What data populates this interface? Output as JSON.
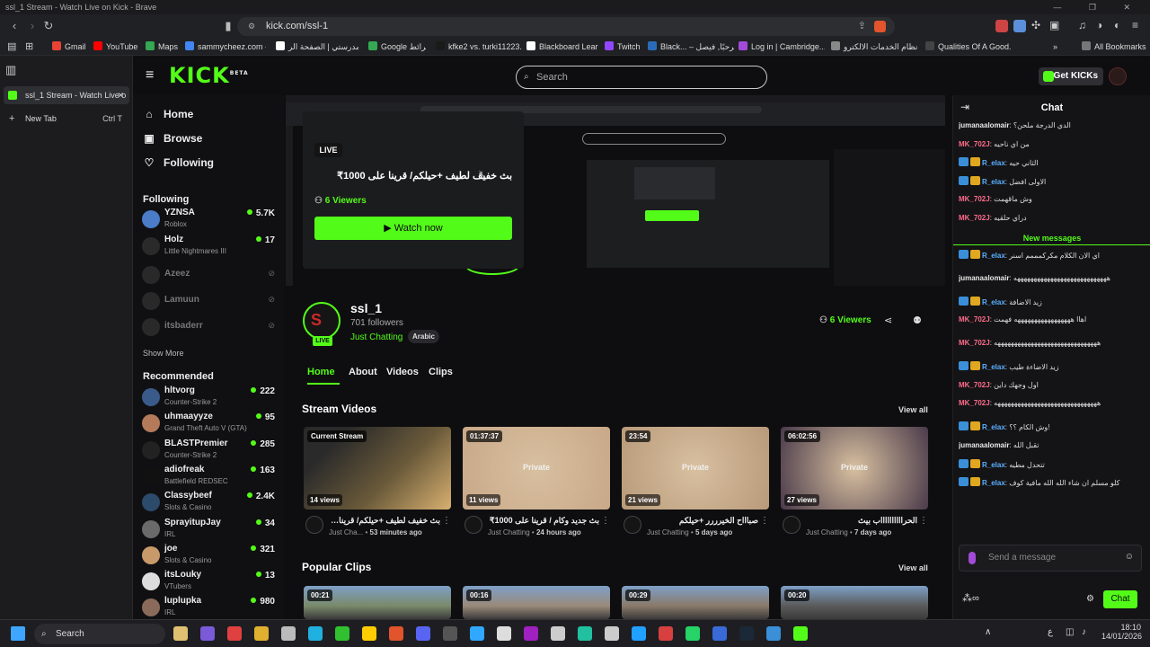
{
  "window": {
    "title": "ssl_1 Stream - Watch Live on Kick - Brave"
  },
  "browser": {
    "url": "kick.com/ssl-1",
    "bookmarks": [
      "Gmail",
      "YouTube",
      "Maps",
      "sammycheez.com -...",
      "مدرستي | الصفحة الر...",
      "Google خرائط",
      "kfke2 vs. turki11223...",
      "Blackboard Learn",
      "Twitch",
      "Black... – مرحبًا, فيصل",
      "Log in | Cambridge...",
      "نظام الخدمات الالكترو...",
      "Qualities Of A Good..."
    ],
    "all_bookmarks": "All Bookmarks",
    "tabs": [
      {
        "label": "ssl_1 Stream - Watch Live o"
      },
      {
        "label": "New Tab",
        "shortcut": "Ctrl T"
      }
    ]
  },
  "kick": {
    "logo": "KICK",
    "logo_beta": "BETA",
    "search_placeholder": "Search",
    "get_kicks": "Get KICKs",
    "nav": {
      "home": "Home",
      "browse": "Browse",
      "following": "Following"
    },
    "following_heading": "Following",
    "following": [
      {
        "name": "YZNSA",
        "game": "Roblox",
        "viewers": "5.7K",
        "color": "#4a7cc7"
      },
      {
        "name": "Holz",
        "game": "Little Nightmares III",
        "viewers": "17",
        "color": "#2a2a2a"
      }
    ],
    "following_offline": [
      {
        "name": "Azeez"
      },
      {
        "name": "Lamuun"
      },
      {
        "name": "itsbaderr"
      }
    ],
    "show_more": "Show More",
    "recommended_heading": "Recommended",
    "recommended": [
      {
        "name": "hltvorg",
        "game": "Counter-Strike 2",
        "viewers": "222",
        "color": "#3a5a8a"
      },
      {
        "name": "uhmaayyze",
        "game": "Grand Theft Auto V (GTA)",
        "viewers": "95",
        "color": "#b47a5a"
      },
      {
        "name": "BLASTPremier",
        "game": "Counter-Strike 2",
        "viewers": "285",
        "color": "#222222"
      },
      {
        "name": "adiofreak",
        "game": "Battlefield REDSEC",
        "viewers": "163",
        "color": "#111111"
      },
      {
        "name": "Classybeef",
        "game": "Slots & Casino",
        "viewers": "2.4K",
        "color": "#2c4a6a"
      },
      {
        "name": "SprayitupJay",
        "game": "IRL",
        "viewers": "34",
        "color": "#6a6a6a"
      },
      {
        "name": "joe",
        "game": "Slots & Casino",
        "viewers": "321",
        "color": "#c89a6a"
      },
      {
        "name": "itsLouky",
        "game": "VTubers",
        "viewers": "13",
        "color": "#dddddd"
      },
      {
        "name": "luplupka",
        "game": "IRL",
        "viewers": "980",
        "color": "#8a6a5a"
      }
    ],
    "offline_card": {
      "live_label": "LIVE",
      "title": "بث خفيف لطيف +حيلكم/ قرينا على 1000₹",
      "viewers": "6 Viewers",
      "watch_now": "Watch now"
    },
    "channel": {
      "name": "ssl_1",
      "followers": "701 followers",
      "category": "Just Chatting",
      "tag": "Arabic",
      "live_badge": "LIVE",
      "viewers": "6 Viewers"
    },
    "tabs": [
      "Home",
      "About",
      "Videos",
      "Clips"
    ],
    "stream_videos": {
      "heading": "Stream Videos",
      "view_all": "View all",
      "items": [
        {
          "label": "Current Stream",
          "views": "14 views",
          "private": "",
          "title": "بث خفيف لطيف +حيلكم/ قرينا على 1000₹",
          "channel": "Just Cha...",
          "when": "53 minutes ago",
          "thumb": "#6a5a3a"
        },
        {
          "label": "01:37:37",
          "views": "11 views",
          "private": "Private",
          "title": "بث جديد وكام / قرينا على 1000₹",
          "channel": "Just Chatting",
          "when": "24 hours ago",
          "thumb": "#c8a888"
        },
        {
          "label": "23:54",
          "views": "21 views",
          "private": "Private",
          "title": "صباااح الخيرررر +حيلكم",
          "channel": "Just Chatting",
          "when": "5 days ago",
          "thumb": "#b89a7a"
        },
        {
          "label": "06:02:56",
          "views": "27 views",
          "private": "Private",
          "title": "الحرااااااااااب بيث",
          "channel": "Just Chatting",
          "when": "7 days ago",
          "thumb": "#4a3a4a"
        }
      ]
    },
    "popular_clips": {
      "heading": "Popular Clips",
      "view_all": "View all",
      "items": [
        {
          "label": "00:21",
          "thumb": "#7a8a6a"
        },
        {
          "label": "00:16",
          "thumb": "#9a8a7a"
        },
        {
          "label": "00:29",
          "thumb": "#8a7a6a"
        },
        {
          "label": "00:20",
          "thumb": "#5a5a5a"
        }
      ]
    },
    "chat": {
      "title": "Chat",
      "new_messages": "New messages",
      "input_placeholder": "Send a message",
      "send_label": "Chat",
      "messages": [
        {
          "user": "jumanaalomair",
          "color": "#e8e8e8",
          "text": "الدي الدرجة ملحن؟",
          "badges": 0
        },
        {
          "user": "MK_702J",
          "color": "#ff6b8a",
          "text": "من اي ناحيه",
          "badges": 0
        },
        {
          "user": "R_elax",
          "color": "#5ab0ff",
          "text": "الثاني حيه",
          "badges": 2
        },
        {
          "user": "R_elax",
          "color": "#5ab0ff",
          "text": "الاولى افضل",
          "badges": 2
        },
        {
          "user": "MK_702J",
          "color": "#ff6b8a",
          "text": "وش ماقهمت",
          "badges": 0
        },
        {
          "user": "MK_702J",
          "color": "#ff6b8a",
          "text": "دراي حلقيه",
          "badges": 0
        },
        {
          "user": "R_elax",
          "color": "#5ab0ff",
          "text": "اي الان الكلام مكركمممم اسنر",
          "badges": 2
        },
        {
          "user": "jumanaalomair",
          "color": "#e8e8e8",
          "text": "ههههههههههههههههههههههههههههه",
          "badges": 0
        },
        {
          "user": "R_elax",
          "color": "#5ab0ff",
          "text": "زيد الاضافة",
          "badges": 2
        },
        {
          "user": "MK_702J",
          "color": "#ff6b8a",
          "text": "اهاا هههههههههههههههههه فهمت",
          "badges": 0
        },
        {
          "user": "MK_702J",
          "color": "#ff6b8a",
          "text": "هههههههههههههههههههههههههههههههه",
          "badges": 0
        },
        {
          "user": "R_elax",
          "color": "#5ab0ff",
          "text": "زيد الاضاءة طيب",
          "badges": 2
        },
        {
          "user": "MK_702J",
          "color": "#ff6b8a",
          "text": "اول وجهك داين",
          "badges": 0
        },
        {
          "user": "MK_702J",
          "color": "#ff6b8a",
          "text": "هههههههههههههههههههههههههههههههه",
          "badges": 0
        },
        {
          "user": "R_elax",
          "color": "#5ab0ff",
          "text": "وش الكام ؟؟!",
          "badges": 2
        },
        {
          "user": "jumanaalomair",
          "color": "#e8e8e8",
          "text": "تقبل الله",
          "badges": 0
        },
        {
          "user": "R_elax",
          "color": "#5ab0ff",
          "text": "تتحدل مطيه",
          "badges": 2
        },
        {
          "user": "R_elax",
          "color": "#5ab0ff",
          "text": "كلو مسلم ان شاء الله الله مافية كوف",
          "badges": 2
        }
      ]
    }
  },
  "taskbar": {
    "search": "Search",
    "time": "18:10",
    "date": "14/01/2026",
    "lang": "ع"
  },
  "colors": {
    "accent": "#53fc18",
    "bg": "#0e0e10",
    "chat_user_pink": "#ff6b8a",
    "chat_user_blue": "#5ab0ff"
  }
}
